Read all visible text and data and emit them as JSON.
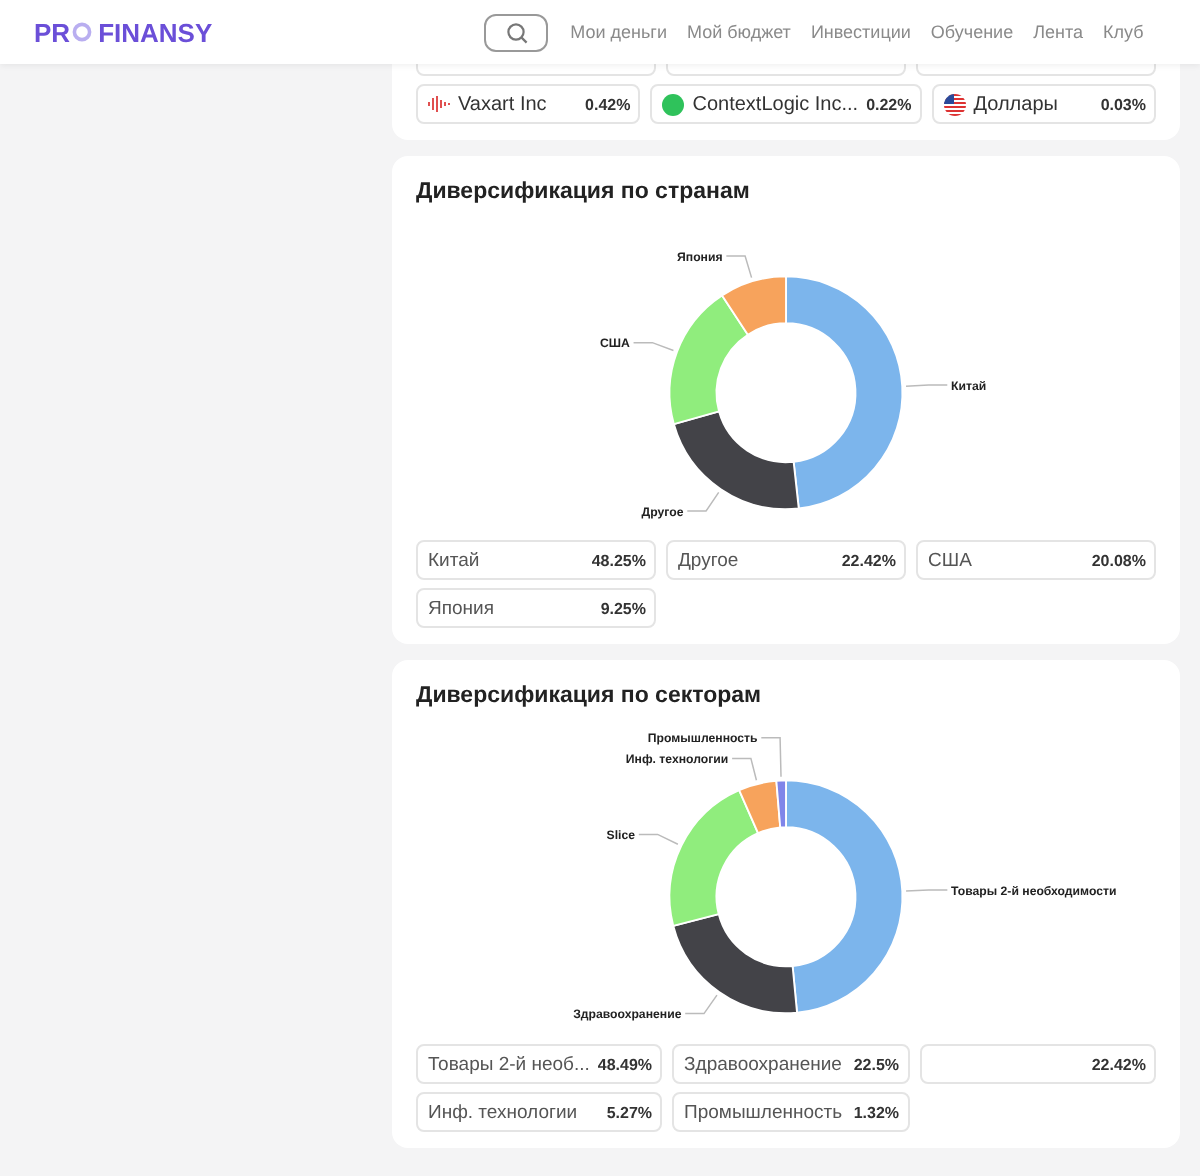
{
  "header": {
    "logo": {
      "left": "PR",
      "right": "FINANSY"
    },
    "nav": [
      "Мои деньги",
      "Мой бюджет",
      "Инвестиции",
      "Обучение",
      "Лента",
      "Клуб"
    ]
  },
  "holdings": [
    {
      "kind": "wave",
      "name": "Vaxart Inc",
      "value": "0.42%"
    },
    {
      "kind": "dot",
      "name": "ContextLogic Inc...",
      "value": "0.22%"
    },
    {
      "kind": "flag",
      "name": "Доллары",
      "value": "0.03%"
    }
  ],
  "sections": [
    {
      "title": "Диверсификация по странам",
      "chart_data": {
        "type": "donut",
        "categories": [
          "Китай",
          "Другое",
          "США",
          "Япония"
        ],
        "series": [
          {
            "values": [
              48.25,
              22.42,
              20.08,
              9.25
            ]
          }
        ],
        "colors": [
          "#7cb5ec",
          "#434348",
          "#90ed7d",
          "#f7a35c"
        ]
      },
      "legend": [
        {
          "name": "Китай",
          "value": "48.25%"
        },
        {
          "name": "Другое",
          "value": "22.42%"
        },
        {
          "name": "США",
          "value": "20.08%"
        },
        {
          "name": "Япония",
          "value": "9.25%"
        }
      ]
    },
    {
      "title": "Диверсификация по секторам",
      "chart_data": {
        "type": "donut",
        "categories": [
          "Товары 2-й необходимости",
          "Здравоохранение",
          "Slice",
          "Инф. технологии",
          "Промышленность"
        ],
        "series": [
          {
            "values": [
              48.49,
              22.5,
              22.42,
              5.27,
              1.32
            ]
          }
        ],
        "colors": [
          "#7cb5ec",
          "#434348",
          "#90ed7d",
          "#f7a35c",
          "#8085e9"
        ]
      },
      "legend": [
        {
          "name": "Товары 2-й необ...",
          "value": "48.49%"
        },
        {
          "name": "Здравоохранение",
          "value": "22.5%"
        },
        {
          "value": "22.42%"
        },
        {
          "name": "Инф. технологии",
          "value": "5.27%"
        },
        {
          "name": "Промышленность",
          "value": "1.32%"
        }
      ]
    }
  ]
}
